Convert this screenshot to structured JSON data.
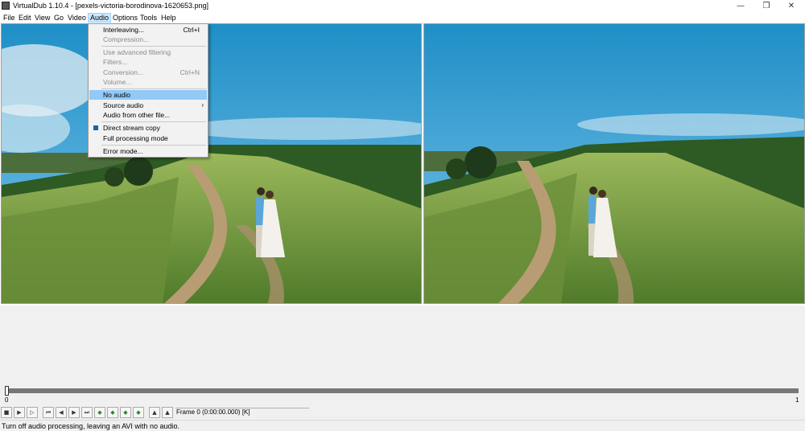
{
  "window": {
    "title": "VirtualDub 1.10.4 - [pexels-victoria-borodinova-1620653.png]",
    "controls": [
      "—",
      "❒",
      "✕"
    ]
  },
  "menubar": [
    "File",
    "Edit",
    "View",
    "Go",
    "Video",
    "Audio",
    "Options",
    "Tools",
    "Help"
  ],
  "audio_menu": {
    "items": [
      {
        "label": "Interleaving...",
        "shortcut": "Ctrl+I",
        "state": "enabled"
      },
      {
        "label": "Compression...",
        "shortcut": "",
        "state": "disabled"
      },
      {
        "label": "Use advanced filtering",
        "shortcut": "",
        "state": "disabled"
      },
      {
        "label": "Filters...",
        "shortcut": "",
        "state": "disabled"
      },
      {
        "label": "Conversion...",
        "shortcut": "Ctrl+N",
        "state": "disabled"
      },
      {
        "label": "Volume...",
        "shortcut": "",
        "state": "disabled"
      },
      {
        "label": "No audio",
        "shortcut": "",
        "state": "highlighted"
      },
      {
        "label": "Source audio",
        "shortcut": "",
        "state": "submenu",
        "arrow": "›"
      },
      {
        "label": "Audio from other file...",
        "shortcut": "",
        "state": "enabled"
      },
      {
        "label": "Direct stream copy",
        "shortcut": "",
        "state": "checked"
      },
      {
        "label": "Full processing mode",
        "shortcut": "",
        "state": "enabled"
      },
      {
        "label": "Error mode...",
        "shortcut": "",
        "state": "enabled"
      }
    ]
  },
  "timeline": {
    "start": "0",
    "end": "1"
  },
  "toolbar": {
    "frame_readout": "Frame 0 (0:00:00.000) [K]"
  },
  "status": {
    "text": "Turn off audio processing, leaving an AVI with no audio."
  },
  "colors": {
    "highlight": "#91c9f7",
    "menu_active": "#cce8ff",
    "check": "#1a5fb4"
  }
}
